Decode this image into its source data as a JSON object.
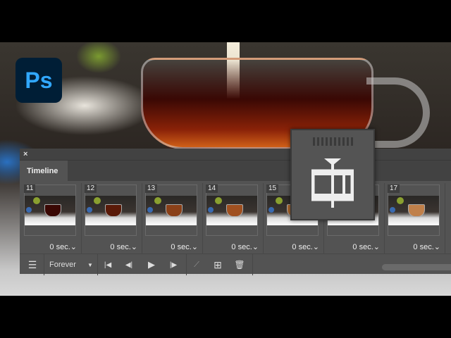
{
  "logo": {
    "text": "Ps"
  },
  "panel": {
    "close_label": "×",
    "tab_label": "Timeline",
    "frames": [
      {
        "num": "11",
        "delay": "0 sec.⌄",
        "tint": "#3a0804"
      },
      {
        "num": "12",
        "delay": "0 sec.⌄",
        "tint": "#5a1a08"
      },
      {
        "num": "13",
        "delay": "0 sec.⌄",
        "tint": "#8a4018"
      },
      {
        "num": "14",
        "delay": "0 sec.⌄",
        "tint": "#a05020"
      },
      {
        "num": "15",
        "delay": "0 sec.⌄",
        "tint": "#b06a30"
      },
      {
        "num": "",
        "delay": "0 sec.⌄",
        "tint": "#b87040"
      },
      {
        "num": "17",
        "delay": "0 sec.⌄",
        "tint": "#c0804a"
      }
    ],
    "toolbar": {
      "loop": "Forever",
      "loop_arrow": "▼",
      "first": "|◀",
      "prev": "◀|",
      "play": "▶",
      "next": "|▶",
      "tween": "⟋",
      "new_frame": "⊞",
      "delete": "🗑",
      "convert": "☰"
    }
  }
}
